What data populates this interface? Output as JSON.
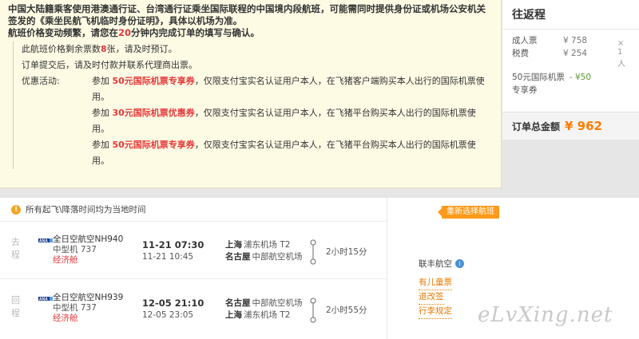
{
  "notice": {
    "lead_text": "中国大陆籍乘客使用港澳通行证、台湾通行证乘坐国际联程的中国境内段航班，可能需同时提供身份证或机场公安机关签发的《乘坐民航飞机临时身份证明》，具体以机场为准。",
    "lead2_prefix": "航班价格变动频繁，请您在",
    "lead2_minutes": "20",
    "lead2_suffix": "分钟内完成订单的填写与确认。",
    "seats_prefix": "此航班价格剩余票数",
    "seats_count": "8",
    "seats_suffix": "张，请及时预订。",
    "pay_notice": "订单提交后，请及时付款并联系代理商出票。",
    "promo_label": "优惠活动:",
    "promos": [
      {
        "prefix": "参加 ",
        "highlight": "50元国际机票专享券",
        "suffix": "，仅限支付宝实名认证用户本人，在飞猪客户端购买本人出行的国际机票使用。"
      },
      {
        "prefix": "参加 ",
        "highlight": "30元国际机票优惠券",
        "suffix": "，仅限支付宝实名认证用户本人，在飞猪平台购买本人出行的国际机票使用。"
      },
      {
        "prefix": "参加 ",
        "highlight": "50元国际机票专享券",
        "suffix": "，仅限支付宝实名认证用户本人，在飞猪平台购买本人出行的国际机票使用。"
      }
    ]
  },
  "summary": {
    "title": "往返程",
    "adult_label": "成人票",
    "adult_price": "¥ 758",
    "tax_label": "税费",
    "tax_price": "¥ 254",
    "multiplier": "× 1 人",
    "coupon_line1": "50元国际机票",
    "coupon_discount": "- ¥50",
    "coupon_line2": "专享券",
    "total_label": "订单总金额",
    "total_amount": "¥ 962"
  },
  "flight": {
    "header": "所有起飞\\降落时间均为当地时间",
    "reselect": "重新选择航班",
    "legs": [
      {
        "tag": "去程",
        "airline": "全日空航空NH940",
        "aircraft": "中型机 737",
        "cabin": "经济舱",
        "dep_time": "11-21 07:30",
        "arr_time": "11-21 10:45",
        "dep_city": "上海",
        "dep_airport": "浦东机场 T2",
        "arr_city": "名古屋",
        "arr_airport": "中部航空机场",
        "duration": "2小时15分"
      },
      {
        "tag": "回程",
        "airline": "全日空航空NH939",
        "aircraft": "中型机 737",
        "cabin": "经济舱",
        "dep_time": "12-05 21:10",
        "arr_time": "12-05 23:05",
        "dep_city": "名古屋",
        "dep_airport": "中部航空机场",
        "arr_city": "上海",
        "arr_airport": "浦东机场 T2",
        "duration": "2小时55分"
      }
    ],
    "alliance": "联丰航空",
    "alliance_badge": "i",
    "links": [
      "有儿童票",
      "退改签",
      "行李规定"
    ]
  },
  "watermark": "eLvXing.net",
  "colors": {
    "accent_red": "#e4393c",
    "accent_orange": "#ff7b00",
    "notice_bg": "#fefbe4"
  }
}
